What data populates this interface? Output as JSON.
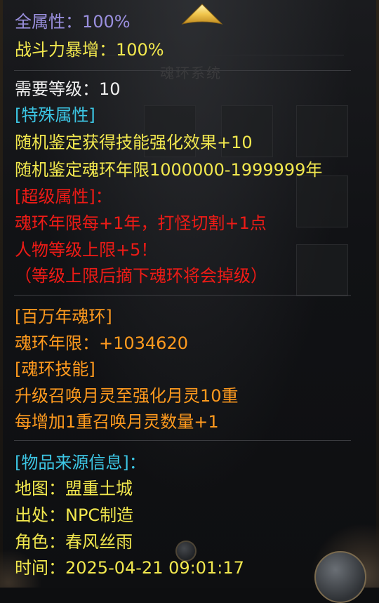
{
  "tooltip": {
    "stats": {
      "all_attributes": "全属性：100%",
      "combat_power": "战斗力暴增：100%",
      "required_level": "需要等级：10"
    },
    "special": {
      "header": "[特殊属性]",
      "line1": "随机鉴定获得技能强化效果+10",
      "line2": "随机鉴定魂环年限1000000-1999999年"
    },
    "super": {
      "header": "[超级属性]：",
      "line1": "魂环年限每+1年，打怪切割+1点",
      "line2": "人物等级上限+5！",
      "line3": "（等级上限后摘下魂环将会掉级）"
    },
    "ring": {
      "header": "[百万年魂环]",
      "years": "魂环年限：+1034620"
    },
    "skill": {
      "header": "[魂环技能]",
      "line1": "升级召唤月灵至强化月灵10重",
      "line2": "每增加1重召唤月灵数量+1"
    },
    "source": {
      "header": "[物品来源信息]：",
      "map": "地图：盟重土城",
      "origin": "出处：NPC制造",
      "character": "角色：春风丝雨",
      "time": "时间：2025-04-21 09:01:17"
    }
  },
  "background": {
    "panel_title": "魂环系统"
  },
  "icons": {
    "collapse": "up-arrow-icon"
  },
  "colors": {
    "lavender": "#9a8fde",
    "yellow": "#f2e84e",
    "white": "#f0f0f0",
    "cyan": "#3cc6e4",
    "red": "#ee1b16",
    "orange": "#ff9a1e"
  }
}
